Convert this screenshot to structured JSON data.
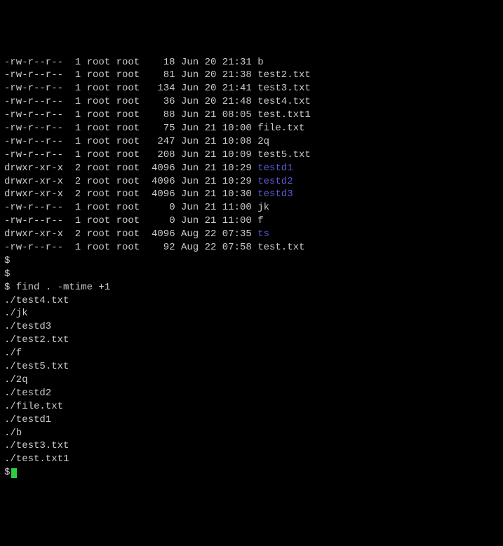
{
  "listing": [
    {
      "perm": "-rw-r--r--",
      "links": "1",
      "owner": "root",
      "group": "root",
      "size": "18",
      "month": "Jun",
      "day": "20",
      "time": "21:31",
      "name": "b",
      "dir": false
    },
    {
      "perm": "-rw-r--r--",
      "links": "1",
      "owner": "root",
      "group": "root",
      "size": "81",
      "month": "Jun",
      "day": "20",
      "time": "21:38",
      "name": "test2.txt",
      "dir": false
    },
    {
      "perm": "-rw-r--r--",
      "links": "1",
      "owner": "root",
      "group": "root",
      "size": "134",
      "month": "Jun",
      "day": "20",
      "time": "21:41",
      "name": "test3.txt",
      "dir": false
    },
    {
      "perm": "-rw-r--r--",
      "links": "1",
      "owner": "root",
      "group": "root",
      "size": "36",
      "month": "Jun",
      "day": "20",
      "time": "21:48",
      "name": "test4.txt",
      "dir": false
    },
    {
      "perm": "-rw-r--r--",
      "links": "1",
      "owner": "root",
      "group": "root",
      "size": "88",
      "month": "Jun",
      "day": "21",
      "time": "08:05",
      "name": "test.txt1",
      "dir": false
    },
    {
      "perm": "-rw-r--r--",
      "links": "1",
      "owner": "root",
      "group": "root",
      "size": "75",
      "month": "Jun",
      "day": "21",
      "time": "10:00",
      "name": "file.txt",
      "dir": false
    },
    {
      "perm": "-rw-r--r--",
      "links": "1",
      "owner": "root",
      "group": "root",
      "size": "247",
      "month": "Jun",
      "day": "21",
      "time": "10:08",
      "name": "2q",
      "dir": false
    },
    {
      "perm": "-rw-r--r--",
      "links": "1",
      "owner": "root",
      "group": "root",
      "size": "208",
      "month": "Jun",
      "day": "21",
      "time": "10:09",
      "name": "test5.txt",
      "dir": false
    },
    {
      "perm": "drwxr-xr-x",
      "links": "2",
      "owner": "root",
      "group": "root",
      "size": "4096",
      "month": "Jun",
      "day": "21",
      "time": "10:29",
      "name": "testd1",
      "dir": true
    },
    {
      "perm": "drwxr-xr-x",
      "links": "2",
      "owner": "root",
      "group": "root",
      "size": "4096",
      "month": "Jun",
      "day": "21",
      "time": "10:29",
      "name": "testd2",
      "dir": true
    },
    {
      "perm": "drwxr-xr-x",
      "links": "2",
      "owner": "root",
      "group": "root",
      "size": "4096",
      "month": "Jun",
      "day": "21",
      "time": "10:30",
      "name": "testd3",
      "dir": true
    },
    {
      "perm": "-rw-r--r--",
      "links": "1",
      "owner": "root",
      "group": "root",
      "size": "0",
      "month": "Jun",
      "day": "21",
      "time": "11:00",
      "name": "jk",
      "dir": false
    },
    {
      "perm": "-rw-r--r--",
      "links": "1",
      "owner": "root",
      "group": "root",
      "size": "0",
      "month": "Jun",
      "day": "21",
      "time": "11:00",
      "name": "f",
      "dir": false
    },
    {
      "perm": "drwxr-xr-x",
      "links": "2",
      "owner": "root",
      "group": "root",
      "size": "4096",
      "month": "Aug",
      "day": "22",
      "time": "07:35",
      "name": "ts",
      "dir": true
    },
    {
      "perm": "-rw-r--r--",
      "links": "1",
      "owner": "root",
      "group": "root",
      "size": "92",
      "month": "Aug",
      "day": "22",
      "time": "07:58",
      "name": "test.txt",
      "dir": false
    }
  ],
  "prompts": {
    "p1": "$",
    "p2": "$",
    "p3": "$",
    "p4": "$"
  },
  "command": " find . -mtime +1",
  "output": [
    "./test4.txt",
    "./jk",
    "./testd3",
    "./test2.txt",
    "./f",
    "./test5.txt",
    "./2q",
    "./testd2",
    "./file.txt",
    "./testd1",
    "./b",
    "./test3.txt",
    "./test.txt1"
  ]
}
